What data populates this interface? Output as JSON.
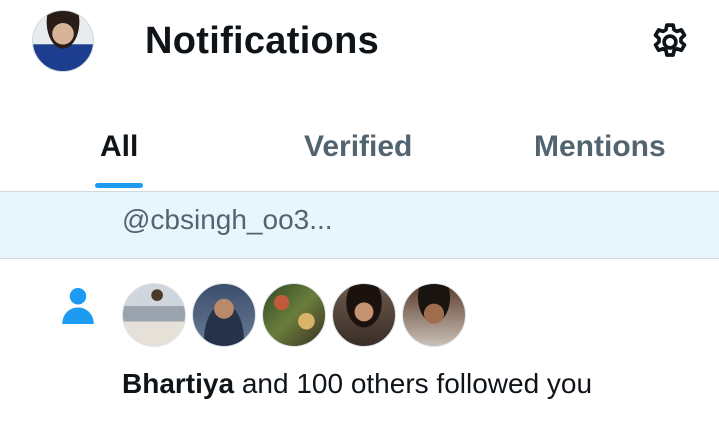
{
  "header": {
    "title": "Notifications",
    "settings_icon": "gear-icon",
    "avatar_icon": "user-avatar"
  },
  "tabs": [
    {
      "label": "All",
      "active": true
    },
    {
      "label": "Verified",
      "active": false
    },
    {
      "label": "Mentions",
      "active": false
    }
  ],
  "mention_preview": {
    "text": "@cbsingh_oo3..."
  },
  "follow_notification": {
    "icon": "person-icon",
    "name": "Bhartiya",
    "rest": " and 100 others followed you",
    "follower_avatars": [
      "follower-avatar-1",
      "follower-avatar-2",
      "follower-avatar-3",
      "follower-avatar-4",
      "follower-avatar-5"
    ]
  },
  "colors": {
    "accent": "#1d9bf0",
    "highlight_bg": "#e8f5fd",
    "secondary_text": "#536471",
    "primary_text": "#0f1419"
  }
}
